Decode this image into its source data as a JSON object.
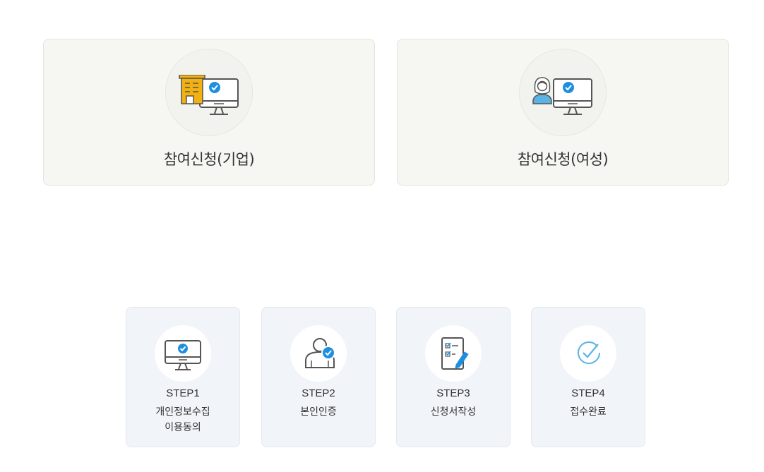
{
  "apply": {
    "corporate_label": "참여신청(기업)",
    "women_label": "참여신청(여성)"
  },
  "steps": [
    {
      "title": "STEP1",
      "desc_line1": "개인정보수집",
      "desc_line2": "이용동의"
    },
    {
      "title": "STEP2",
      "desc_line1": "본인인증",
      "desc_line2": ""
    },
    {
      "title": "STEP3",
      "desc_line1": "신청서작성",
      "desc_line2": ""
    },
    {
      "title": "STEP4",
      "desc_line1": "접수완료",
      "desc_line2": ""
    }
  ],
  "colors": {
    "accent_blue": "#1e8fe0",
    "building_yellow": "#f2b111",
    "apply_card_bg": "#f6f7f2",
    "step_card_bg": "#f1f4f9"
  },
  "icons": {
    "corporate": "building-monitor-icon",
    "women": "woman-monitor-icon",
    "step1": "monitor-check-icon",
    "step2": "person-check-icon",
    "step3": "checklist-pen-icon",
    "step4": "checkmark-circle-icon"
  }
}
